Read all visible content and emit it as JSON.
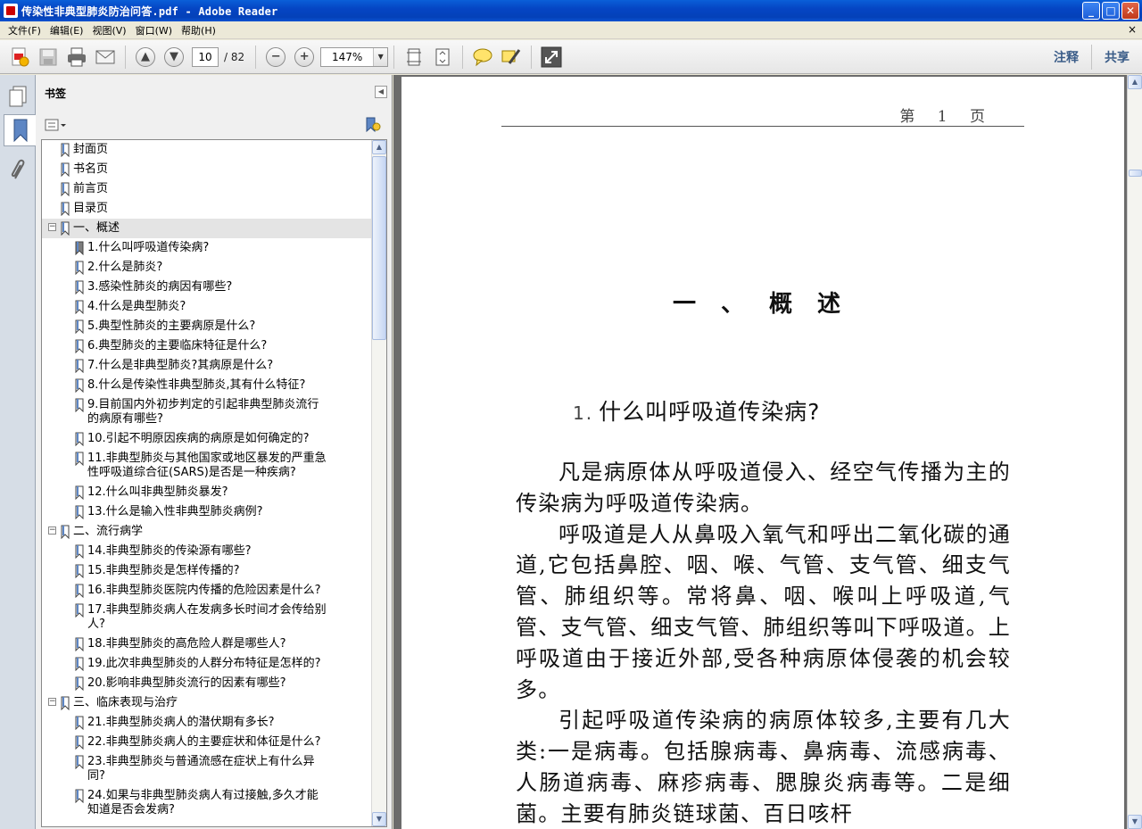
{
  "window": {
    "title": "传染性非典型肺炎防治问答.pdf - Adobe Reader",
    "buttons": {
      "minimize": "_",
      "maximize": "□",
      "close": "✕"
    }
  },
  "menu": [
    "文件(F)",
    "编辑(E)",
    "视图(V)",
    "窗口(W)",
    "帮助(H)"
  ],
  "menu_close": "×",
  "toolbar": {
    "page_current": "10",
    "page_total": "/ 82",
    "zoom": "147%",
    "comment": "注释",
    "share": "共享"
  },
  "bookmarks_panel": {
    "title": "书签",
    "items": [
      {
        "level": 0,
        "label": "封面页"
      },
      {
        "level": 0,
        "label": "书名页"
      },
      {
        "level": 0,
        "label": "前言页"
      },
      {
        "level": 0,
        "label": "目录页"
      },
      {
        "level": 0,
        "label": "一、概述",
        "expandable": true,
        "selected": true
      },
      {
        "level": 1,
        "label": "1.什么叫呼吸道传染病?",
        "current": true
      },
      {
        "level": 1,
        "label": "2.什么是肺炎?"
      },
      {
        "level": 1,
        "label": "3.感染性肺炎的病因有哪些?"
      },
      {
        "level": 1,
        "label": "4.什么是典型肺炎?"
      },
      {
        "level": 1,
        "label": "5.典型性肺炎的主要病原是什么?"
      },
      {
        "level": 1,
        "label": "6.典型肺炎的主要临床特征是什么?"
      },
      {
        "level": 1,
        "label": "7.什么是非典型肺炎?其病原是什么?"
      },
      {
        "level": 1,
        "label": "8.什么是传染性非典型肺炎,其有什么特征?"
      },
      {
        "level": 1,
        "label": "9.目前国内外初步判定的引起非典型肺炎流行的病原有哪些?",
        "lines": [
          "9.目前国内外初步判定的引起非典型肺炎流行",
          "的病原有哪些?"
        ]
      },
      {
        "level": 1,
        "label": "10.引起不明原因疾病的病原是如何确定的?"
      },
      {
        "level": 1,
        "label": "11.非典型肺炎与其他国家或地区暴发的严重急性呼吸道综合征(SARS)是否是一种疾病?",
        "lines": [
          "11.非典型肺炎与其他国家或地区暴发的严重急",
          "性呼吸道综合征(SARS)是否是一种疾病?"
        ]
      },
      {
        "level": 1,
        "label": "12.什么叫非典型肺炎暴发?"
      },
      {
        "level": 1,
        "label": "13.什么是输入性非典型肺炎病例?"
      },
      {
        "level": 0,
        "label": "二、流行病学",
        "expandable": true
      },
      {
        "level": 1,
        "label": "14.非典型肺炎的传染源有哪些?"
      },
      {
        "level": 1,
        "label": "15.非典型肺炎是怎样传播的?"
      },
      {
        "level": 1,
        "label": "16.非典型肺炎医院内传播的危险因素是什么?"
      },
      {
        "level": 1,
        "label": "17.非典型肺炎病人在发病多长时间才会传给别人?",
        "lines": [
          "17.非典型肺炎病人在发病多长时间才会传给别",
          "人?"
        ]
      },
      {
        "level": 1,
        "label": "18.非典型肺炎的高危险人群是哪些人?"
      },
      {
        "level": 1,
        "label": "19.此次非典型肺炎的人群分布特征是怎样的?"
      },
      {
        "level": 1,
        "label": "20.影响非典型肺炎流行的因素有哪些?"
      },
      {
        "level": 0,
        "label": "三、临床表现与治疗",
        "expandable": true
      },
      {
        "level": 1,
        "label": "21.非典型肺炎病人的潜伏期有多长?"
      },
      {
        "level": 1,
        "label": "22.非典型肺炎病人的主要症状和体征是什么?"
      },
      {
        "level": 1,
        "label": "23.非典型肺炎与普通流感在症状上有什么异同?",
        "lines": [
          "23.非典型肺炎与普通流感在症状上有什么异",
          "同?"
        ]
      },
      {
        "level": 1,
        "label": "24.如果与非典型肺炎病人有过接触,多久才能知道是否会发病?",
        "lines": [
          "24.如果与非典型肺炎病人有过接触,多久才能",
          "知道是否会发病?"
        ]
      }
    ]
  },
  "document": {
    "page_header": "第 1 页",
    "chapter_title": "一、概述",
    "question_number": "1.",
    "question_title": "什么叫呼吸道传染病?",
    "paragraphs": [
      "凡是病原体从呼吸道侵入、经空气传播为主的传染病为呼吸道传染病。",
      "呼吸道是人从鼻吸入氧气和呼出二氧化碳的通道,它包括鼻腔、咽、喉、气管、支气管、细支气管、肺组织等。常将鼻、咽、喉叫上呼吸道,气管、支气管、细支气管、肺组织等叫下呼吸道。上呼吸道由于接近外部,受各种病原体侵袭的机会较多。",
      "引起呼吸道传染病的病原体较多,主要有几大类:一是病毒。包括腺病毒、鼻病毒、流感病毒、人肠道病毒、麻疹病毒、腮腺炎病毒等。二是细菌。主要有肺炎链球菌、百日咳杆"
    ]
  }
}
